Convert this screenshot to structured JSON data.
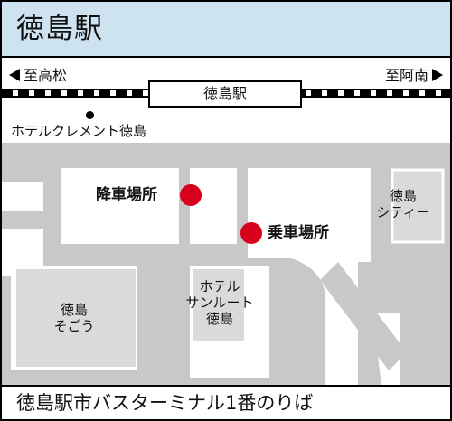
{
  "header": {
    "title": "徳島駅"
  },
  "railway": {
    "west_label": "至高松",
    "east_label": "至阿南",
    "station_label": "徳島駅"
  },
  "landmarks": {
    "hotel_clement": "ホテルクレメント徳島",
    "tokushima_city_line1": "徳島",
    "tokushima_city_line2": "シティー",
    "sogo_line1": "徳島",
    "sogo_line2": "そごう",
    "hotel_sunroute_line1": "ホテル",
    "hotel_sunroute_line2": "サンルート",
    "hotel_sunroute_line3": "徳島"
  },
  "bus_stops": {
    "dropoff": "降車場所",
    "pickup": "乗車場所"
  },
  "footer": {
    "caption": "徳島駅市バスターミナル1番のりば"
  },
  "colors": {
    "header_bg": "#cde3ef",
    "road": "#c8c8c8",
    "block": "#ffffff",
    "building": "#dadada",
    "stop_marker": "#d9001b"
  }
}
